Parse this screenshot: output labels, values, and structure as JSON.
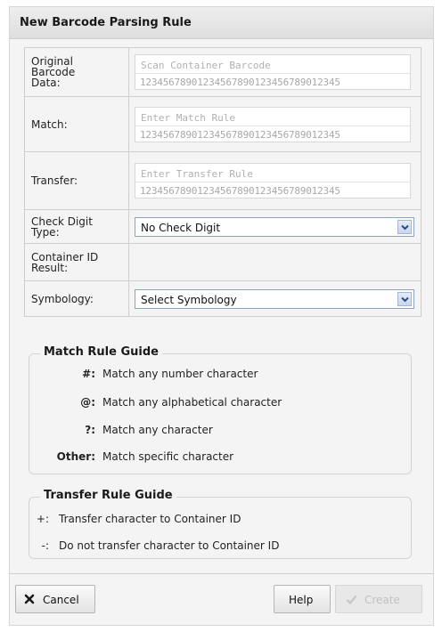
{
  "dialog": {
    "title": "New Barcode Parsing Rule"
  },
  "form": {
    "original": {
      "label": "Original Barcode Data:",
      "placeholder": "Scan Container Barcode",
      "ruler": "12345678901234567890123456789012345"
    },
    "match": {
      "label": "Match:",
      "placeholder": "Enter Match Rule",
      "ruler": "12345678901234567890123456789012345"
    },
    "transfer": {
      "label": "Transfer:",
      "placeholder": "Enter Transfer Rule",
      "ruler": "12345678901234567890123456789012345"
    },
    "check_digit": {
      "label": "Check Digit Type:",
      "value": "No Check Digit"
    },
    "container_id": {
      "label": "Container ID Result:",
      "value": ""
    },
    "symbology": {
      "label": "Symbology:",
      "value": "Select Symbology"
    }
  },
  "match_guide": {
    "title": "Match Rule Guide",
    "rows": [
      {
        "key": "#:",
        "text": "Match any number character"
      },
      {
        "key": "@:",
        "text": "Match any alphabetical character"
      },
      {
        "key": "?:",
        "text": "Match any character"
      },
      {
        "key": "Other:",
        "text": "Match specific character"
      }
    ]
  },
  "transfer_guide": {
    "title": "Transfer Rule Guide",
    "rows": [
      {
        "key": "+:",
        "text": "Transfer character to Container ID"
      },
      {
        "key": "-:",
        "text": "Do not transfer character to Container ID"
      }
    ]
  },
  "footer": {
    "cancel_label": "Cancel",
    "help_label": "Help",
    "create_label": "Create"
  }
}
